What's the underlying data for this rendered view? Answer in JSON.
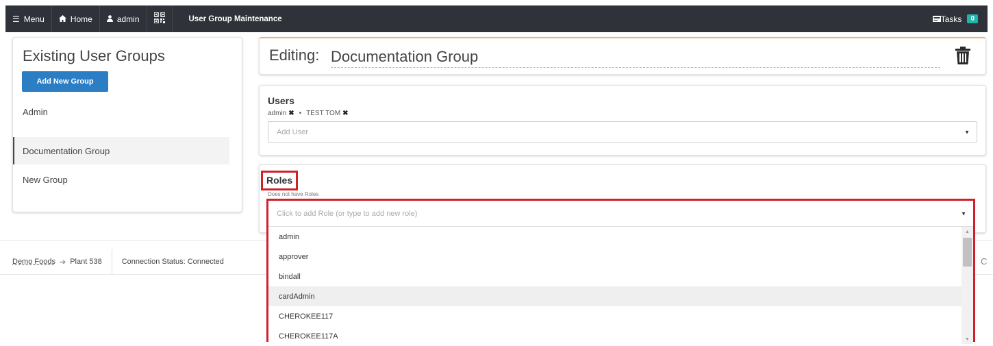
{
  "topbar": {
    "menu_label": "Menu",
    "home_label": "Home",
    "user_label": "admin",
    "page_title": "User Group Maintenance",
    "tasks_label": "Tasks",
    "tasks_count": "0"
  },
  "left_panel": {
    "title": "Existing User Groups",
    "add_button": "Add New Group",
    "groups": [
      "Admin",
      "Documentation Group",
      "New Group"
    ]
  },
  "editor": {
    "label": "Editing:",
    "group_name": "Documentation Group"
  },
  "users": {
    "title": "Users",
    "members": [
      "admin",
      "TEST TOM"
    ],
    "add_placeholder": "Add User"
  },
  "roles": {
    "title": "Roles",
    "subtitle": "Does not have Roles",
    "placeholder": "Click to add Role (or type to add new role)",
    "options": [
      "admin",
      "approver",
      "bindall",
      "cardAdmin",
      "CHEROKEE117",
      "CHEROKEE117A"
    ],
    "highlighted": "cardAdmin"
  },
  "footer": {
    "org": "Demo Foods",
    "plant": "Plant 538",
    "connection": "Connection Status: Connected"
  },
  "colors": {
    "topbar": "#2f3238",
    "primary_button": "#2b7dc4",
    "tasks_badge": "#1fb5ac",
    "highlight_border": "#d0202a"
  }
}
